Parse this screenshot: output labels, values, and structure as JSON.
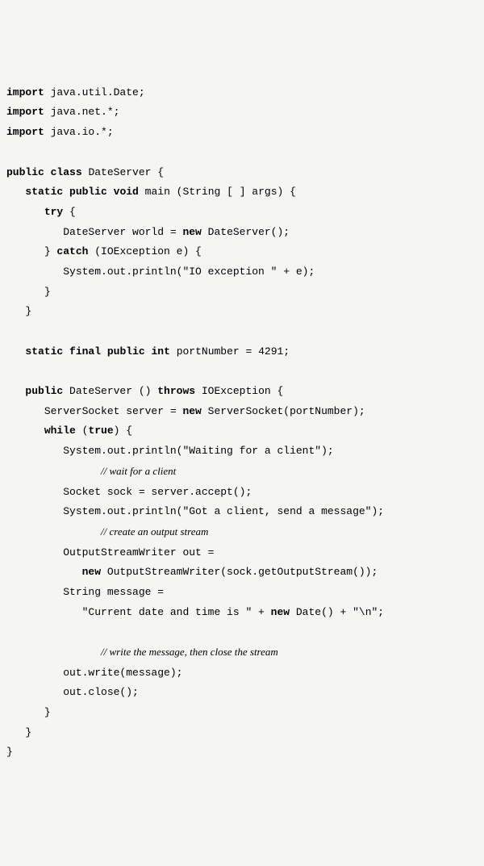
{
  "code": {
    "lines": [
      {
        "indent": 0,
        "segments": [
          {
            "t": "import",
            "c": "kw"
          },
          {
            "t": " java.util.Date;"
          }
        ]
      },
      {
        "indent": 0,
        "segments": [
          {
            "t": "import",
            "c": "kw"
          },
          {
            "t": " java.net.*;"
          }
        ]
      },
      {
        "indent": 0,
        "segments": [
          {
            "t": "import",
            "c": "kw"
          },
          {
            "t": " java.io.*;"
          }
        ]
      },
      {
        "indent": 0,
        "segments": [
          {
            "t": ""
          }
        ]
      },
      {
        "indent": 0,
        "segments": [
          {
            "t": "public",
            "c": "kw"
          },
          {
            "t": " "
          },
          {
            "t": "class",
            "c": "kw"
          },
          {
            "t": " DateServer {"
          }
        ]
      },
      {
        "indent": 1,
        "segments": [
          {
            "t": "static",
            "c": "kw"
          },
          {
            "t": " "
          },
          {
            "t": "public",
            "c": "kw"
          },
          {
            "t": " "
          },
          {
            "t": "void",
            "c": "kw"
          },
          {
            "t": " main (String [ ] args) {"
          }
        ]
      },
      {
        "indent": 2,
        "segments": [
          {
            "t": "try",
            "c": "kw"
          },
          {
            "t": " {"
          }
        ]
      },
      {
        "indent": 3,
        "segments": [
          {
            "t": "DateServer world = "
          },
          {
            "t": "new",
            "c": "kw"
          },
          {
            "t": " DateServer();"
          }
        ]
      },
      {
        "indent": 2,
        "segments": [
          {
            "t": "} "
          },
          {
            "t": "catch",
            "c": "kw"
          },
          {
            "t": " (IOException e) {"
          }
        ]
      },
      {
        "indent": 3,
        "segments": [
          {
            "t": "System.out.println(\"IO exception \" + e);"
          }
        ]
      },
      {
        "indent": 2,
        "segments": [
          {
            "t": "}"
          }
        ]
      },
      {
        "indent": 1,
        "segments": [
          {
            "t": "}"
          }
        ]
      },
      {
        "indent": 0,
        "segments": [
          {
            "t": ""
          }
        ]
      },
      {
        "indent": 1,
        "segments": [
          {
            "t": "static",
            "c": "kw"
          },
          {
            "t": " "
          },
          {
            "t": "final",
            "c": "kw"
          },
          {
            "t": " "
          },
          {
            "t": "public",
            "c": "kw"
          },
          {
            "t": " "
          },
          {
            "t": "int",
            "c": "kw"
          },
          {
            "t": " portNumber = 4291;"
          }
        ]
      },
      {
        "indent": 0,
        "segments": [
          {
            "t": ""
          }
        ]
      },
      {
        "indent": 1,
        "segments": [
          {
            "t": "public",
            "c": "kw"
          },
          {
            "t": " DateServer () "
          },
          {
            "t": "throws",
            "c": "kw"
          },
          {
            "t": " IOException {"
          }
        ]
      },
      {
        "indent": 2,
        "segments": [
          {
            "t": "ServerSocket server = "
          },
          {
            "t": "new",
            "c": "kw"
          },
          {
            "t": " ServerSocket(portNumber);"
          }
        ]
      },
      {
        "indent": 2,
        "segments": [
          {
            "t": "while",
            "c": "kw"
          },
          {
            "t": " ("
          },
          {
            "t": "true",
            "c": "kw"
          },
          {
            "t": ") {"
          }
        ]
      },
      {
        "indent": 3,
        "segments": [
          {
            "t": "System.out.println(\"Waiting for a client\");"
          }
        ]
      },
      {
        "indent": 5,
        "segments": [
          {
            "t": "// wait for a client",
            "c": "comment"
          }
        ]
      },
      {
        "indent": 3,
        "segments": [
          {
            "t": "Socket sock = server.accept();"
          }
        ]
      },
      {
        "indent": 3,
        "segments": [
          {
            "t": "System.out.println(\"Got a client, send a message\");"
          }
        ]
      },
      {
        "indent": 5,
        "segments": [
          {
            "t": "// create an output stream",
            "c": "comment"
          }
        ]
      },
      {
        "indent": 3,
        "segments": [
          {
            "t": "OutputStreamWriter out ="
          }
        ]
      },
      {
        "indent": 4,
        "segments": [
          {
            "t": "new",
            "c": "kw"
          },
          {
            "t": " OutputStreamWriter(sock.getOutputStream());"
          }
        ]
      },
      {
        "indent": 3,
        "segments": [
          {
            "t": "String message ="
          }
        ]
      },
      {
        "indent": 4,
        "segments": [
          {
            "t": "\"Current date and time is \" + "
          },
          {
            "t": "new",
            "c": "kw"
          },
          {
            "t": " Date() + \"\\n\";"
          }
        ]
      },
      {
        "indent": 0,
        "segments": [
          {
            "t": ""
          }
        ]
      },
      {
        "indent": 5,
        "segments": [
          {
            "t": "// write the message, then close the stream",
            "c": "comment"
          }
        ]
      },
      {
        "indent": 3,
        "segments": [
          {
            "t": "out.write(message);"
          }
        ]
      },
      {
        "indent": 3,
        "segments": [
          {
            "t": "out.close();"
          }
        ]
      },
      {
        "indent": 2,
        "segments": [
          {
            "t": "}"
          }
        ]
      },
      {
        "indent": 1,
        "segments": [
          {
            "t": "}"
          }
        ]
      },
      {
        "indent": 0,
        "segments": [
          {
            "t": "}"
          }
        ]
      }
    ],
    "indentUnit": "   "
  }
}
